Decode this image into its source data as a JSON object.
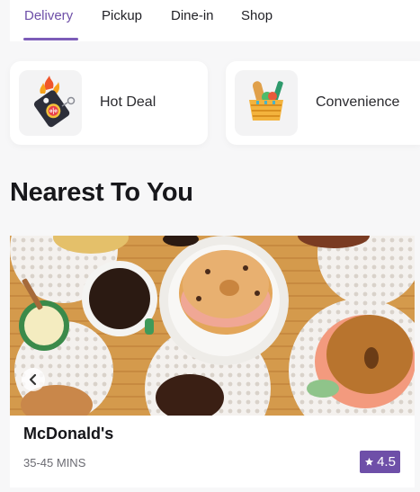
{
  "tabs": [
    {
      "label": "Delivery",
      "active": true
    },
    {
      "label": "Pickup",
      "active": false
    },
    {
      "label": "Dine-in",
      "active": false
    },
    {
      "label": "Shop",
      "active": false
    }
  ],
  "categories": [
    {
      "label": "Hot Deal",
      "icon": "hot-deal-tag-icon"
    },
    {
      "label": "Convenience",
      "icon": "grocery-basket-icon"
    }
  ],
  "section": {
    "title": "Nearest To You"
  },
  "restaurant": {
    "name": "McDonald's",
    "delivery_time": "35-45 MINS",
    "rating": "4.5",
    "image": "bagels-and-coffee-photo"
  },
  "colors": {
    "accent": "#6e4fa8",
    "background": "#f7f7f8",
    "card": "#ffffff"
  }
}
